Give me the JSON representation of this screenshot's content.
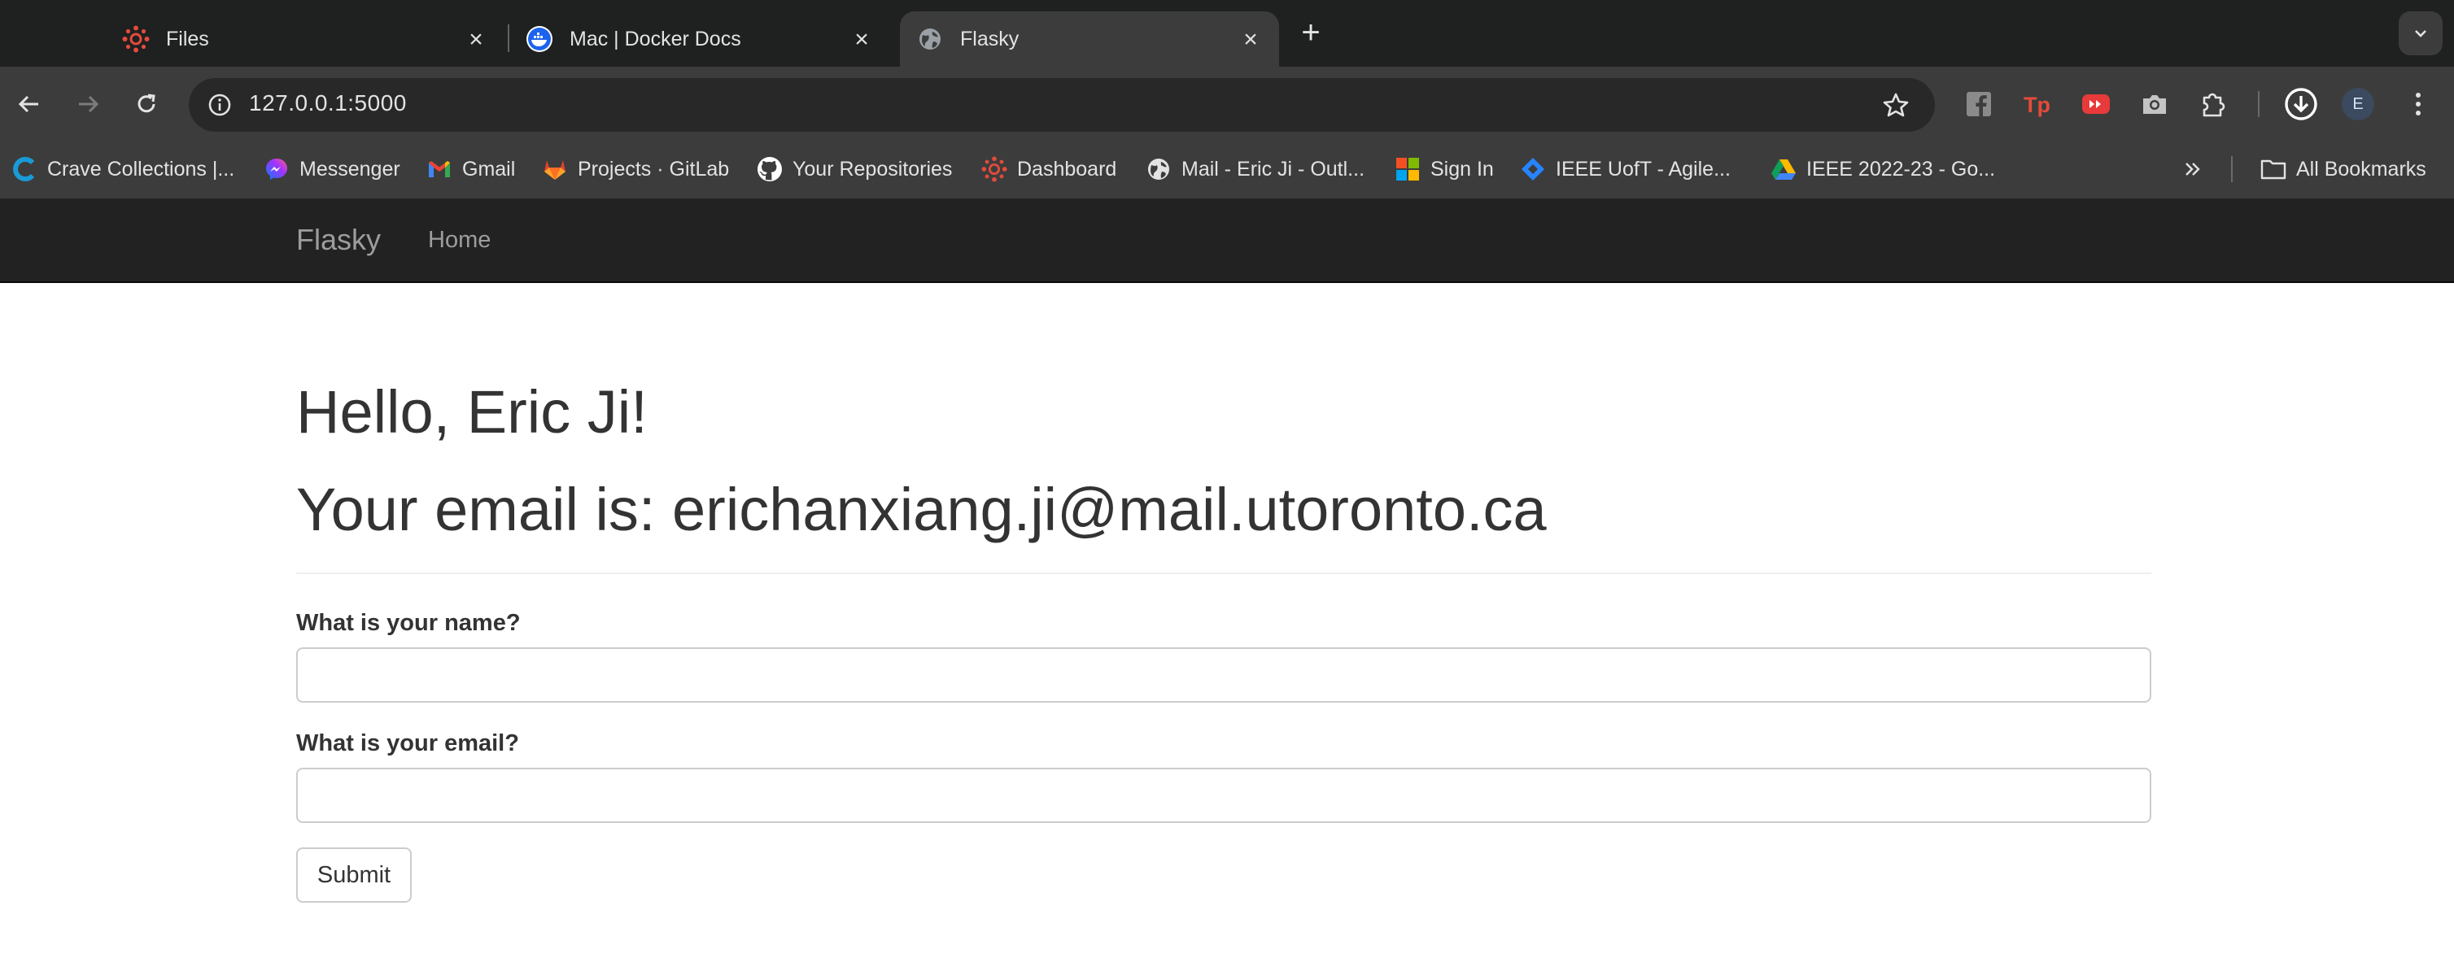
{
  "browser": {
    "tabs": [
      {
        "title": "Files",
        "icon": "canvas-lms-icon",
        "active": false
      },
      {
        "title": "Mac | Docker Docs",
        "icon": "docker-icon",
        "active": false
      },
      {
        "title": "Flasky",
        "icon": "globe-icon",
        "active": true
      }
    ],
    "url": "127.0.0.1:5000",
    "profile_initial": "E",
    "bookmarks": [
      {
        "label": "Crave Collections |...",
        "icon": "crave-icon"
      },
      {
        "label": "Messenger",
        "icon": "messenger-icon"
      },
      {
        "label": "Gmail",
        "icon": "gmail-icon"
      },
      {
        "label": "Projects · GitLab",
        "icon": "gitlab-icon"
      },
      {
        "label": "Your Repositories",
        "icon": "github-icon"
      },
      {
        "label": "Dashboard",
        "icon": "canvas-lms-icon"
      },
      {
        "label": "Mail - Eric Ji - Outl...",
        "icon": "globe-icon"
      },
      {
        "label": "Sign In",
        "icon": "microsoft-icon"
      },
      {
        "label": "IEEE UofT - Agile...",
        "icon": "jira-icon"
      },
      {
        "label": "IEEE 2022-23 - Go...",
        "icon": "google-drive-icon"
      }
    ],
    "all_bookmarks_label": "All Bookmarks"
  },
  "site": {
    "brand": "Flasky",
    "nav_home": "Home",
    "greeting": "Hello, Eric Ji!",
    "email_line": "Your email is: erichanxiang.ji@mail.utoronto.ca",
    "form": {
      "name_label": "What is your name?",
      "name_value": "",
      "email_label": "What is your email?",
      "email_value": "",
      "submit_label": "Submit"
    }
  },
  "colors": {
    "chrome_dark": "#1f2020",
    "chrome_toolbar": "#3c3c3c",
    "navbar": "#222222",
    "heading_text": "#333333",
    "accent_red": "#e34b3b"
  }
}
